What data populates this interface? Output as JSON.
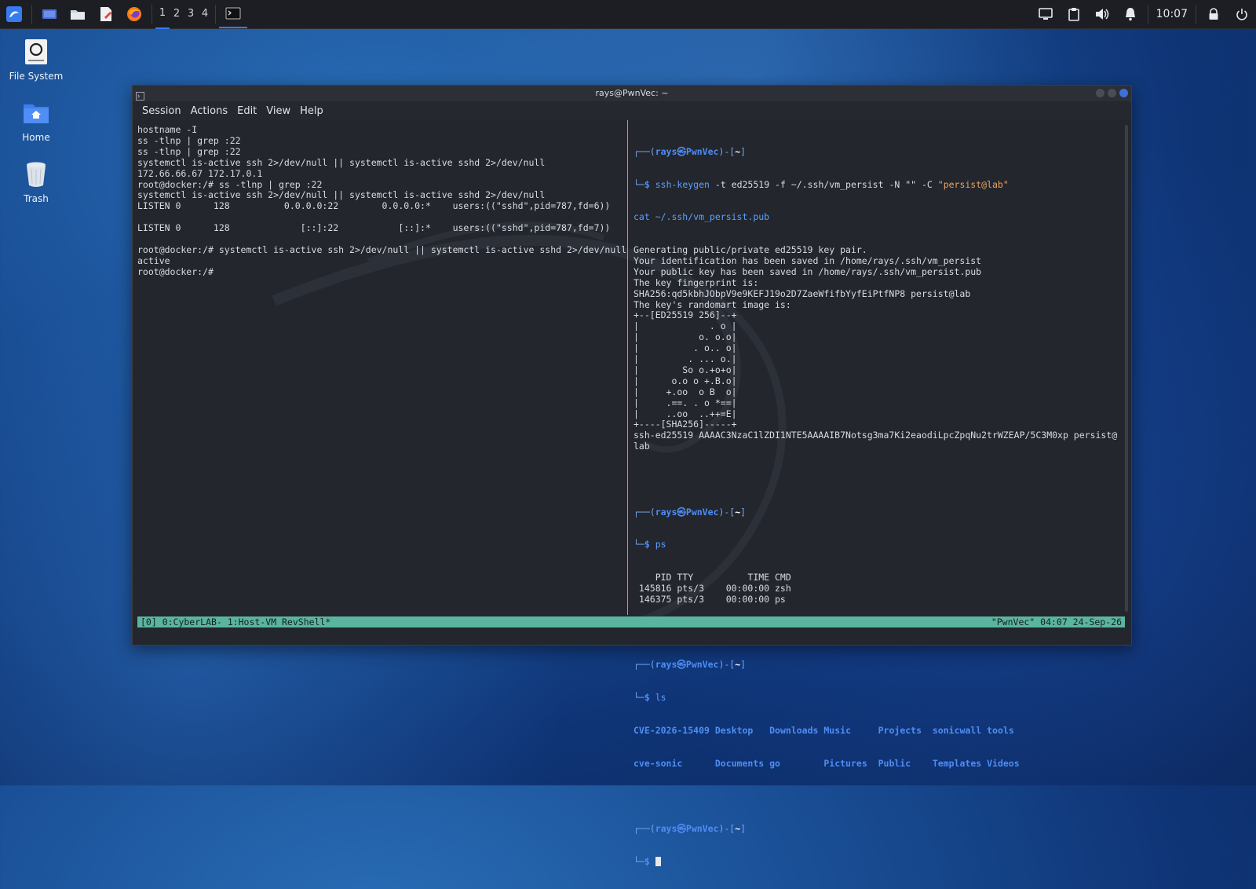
{
  "desktop": {
    "icons": [
      {
        "label": "File System",
        "icon": "drive-icon"
      },
      {
        "label": "Home",
        "icon": "home-folder-icon"
      },
      {
        "label": "Trash",
        "icon": "trash-icon"
      }
    ]
  },
  "taskbar": {
    "workspaces": [
      "1",
      "2",
      "3",
      "4"
    ],
    "active_workspace": "1",
    "clock": "10:07",
    "accent": "#367bf0"
  },
  "window": {
    "title": "rays@PwnVec: ~",
    "menu": [
      "Session",
      "Actions",
      "Edit",
      "View",
      "Help"
    ]
  },
  "left_pane": {
    "lines": [
      "hostname -I",
      "ss -tlnp | grep :22",
      "ss -tlnp | grep :22",
      "systemctl is-active ssh 2>/dev/null || systemctl is-active sshd 2>/dev/null",
      "172.66.66.67 172.17.0.1",
      "root@docker:/# ss -tlnp | grep :22",
      "systemctl is-active ssh 2>/dev/null || systemctl is-active sshd 2>/dev/null",
      "LISTEN 0      128          0.0.0.0:22        0.0.0.0:*    users:((\"sshd\",pid=787,fd=6))",
      "",
      "LISTEN 0      128             [::]:22           [::]:*    users:((\"sshd\",pid=787,fd=7))",
      "",
      "root@docker:/# systemctl is-active ssh 2>/dev/null || systemctl is-active sshd 2>/dev/null",
      "active",
      "root@docker:/#"
    ]
  },
  "right_pane": {
    "prompt_user": "rays",
    "prompt_host": "PwnVec",
    "prompt_path": "~",
    "keygen_cmd": "ssh-keygen",
    "keygen_args": " -t ed25519 -f ~/.ssh/vm_persist -N \"\" -C ",
    "keygen_comment": "\"persist@lab\"",
    "cat_cmd": "cat ~/.ssh/vm_persist.pub",
    "keygen_output": [
      "Generating public/private ed25519 key pair.",
      "Your identification has been saved in /home/rays/.ssh/vm_persist",
      "Your public key has been saved in /home/rays/.ssh/vm_persist.pub",
      "The key fingerprint is:",
      "SHA256:qd5kbhJObpV9e9KEFJ19o2D7ZaeWfifbYyfEiPtfNP8 persist@lab",
      "The key's randomart image is:",
      "+--[ED25519 256]--+",
      "|             . o |",
      "|           o. o.o|",
      "|          . o.. o|",
      "|         . ... o.|",
      "|        So o.+o+o|",
      "|      o.o o +.B.o|",
      "|     +.oo  o B  o|",
      "|     .==. . o *==|",
      "|     ..oo  ..++=E|",
      "+----[SHA256]-----+",
      "ssh-ed25519 AAAAC3NzaC1lZDI1NTE5AAAAIB7Notsg3ma7Ki2eaodiLpcZpqNu2trWZEAP/5C3M0xp persist@",
      "lab"
    ],
    "ps_cmd": "ps",
    "ps_output": [
      "    PID TTY          TIME CMD",
      " 145816 pts/3    00:00:00 zsh",
      " 146375 pts/3    00:00:00 ps"
    ],
    "ls_cmd": "ls",
    "ls_row1": [
      "CVE-2026-15409",
      "Desktop",
      "Downloads",
      "Music",
      "Projects",
      "sonicwall",
      "tools"
    ],
    "ls_row2": [
      "cve-sonic",
      "Documents",
      "go",
      "Pictures",
      "Public",
      "Templates",
      "Videos"
    ]
  },
  "statusbar": {
    "left": "[0] 0:CyberLAB- 1:Host-VM RevShell*",
    "right": "\"PwnVec\" 04:07 24-Sep-26",
    "color": "#5ab5a0"
  }
}
